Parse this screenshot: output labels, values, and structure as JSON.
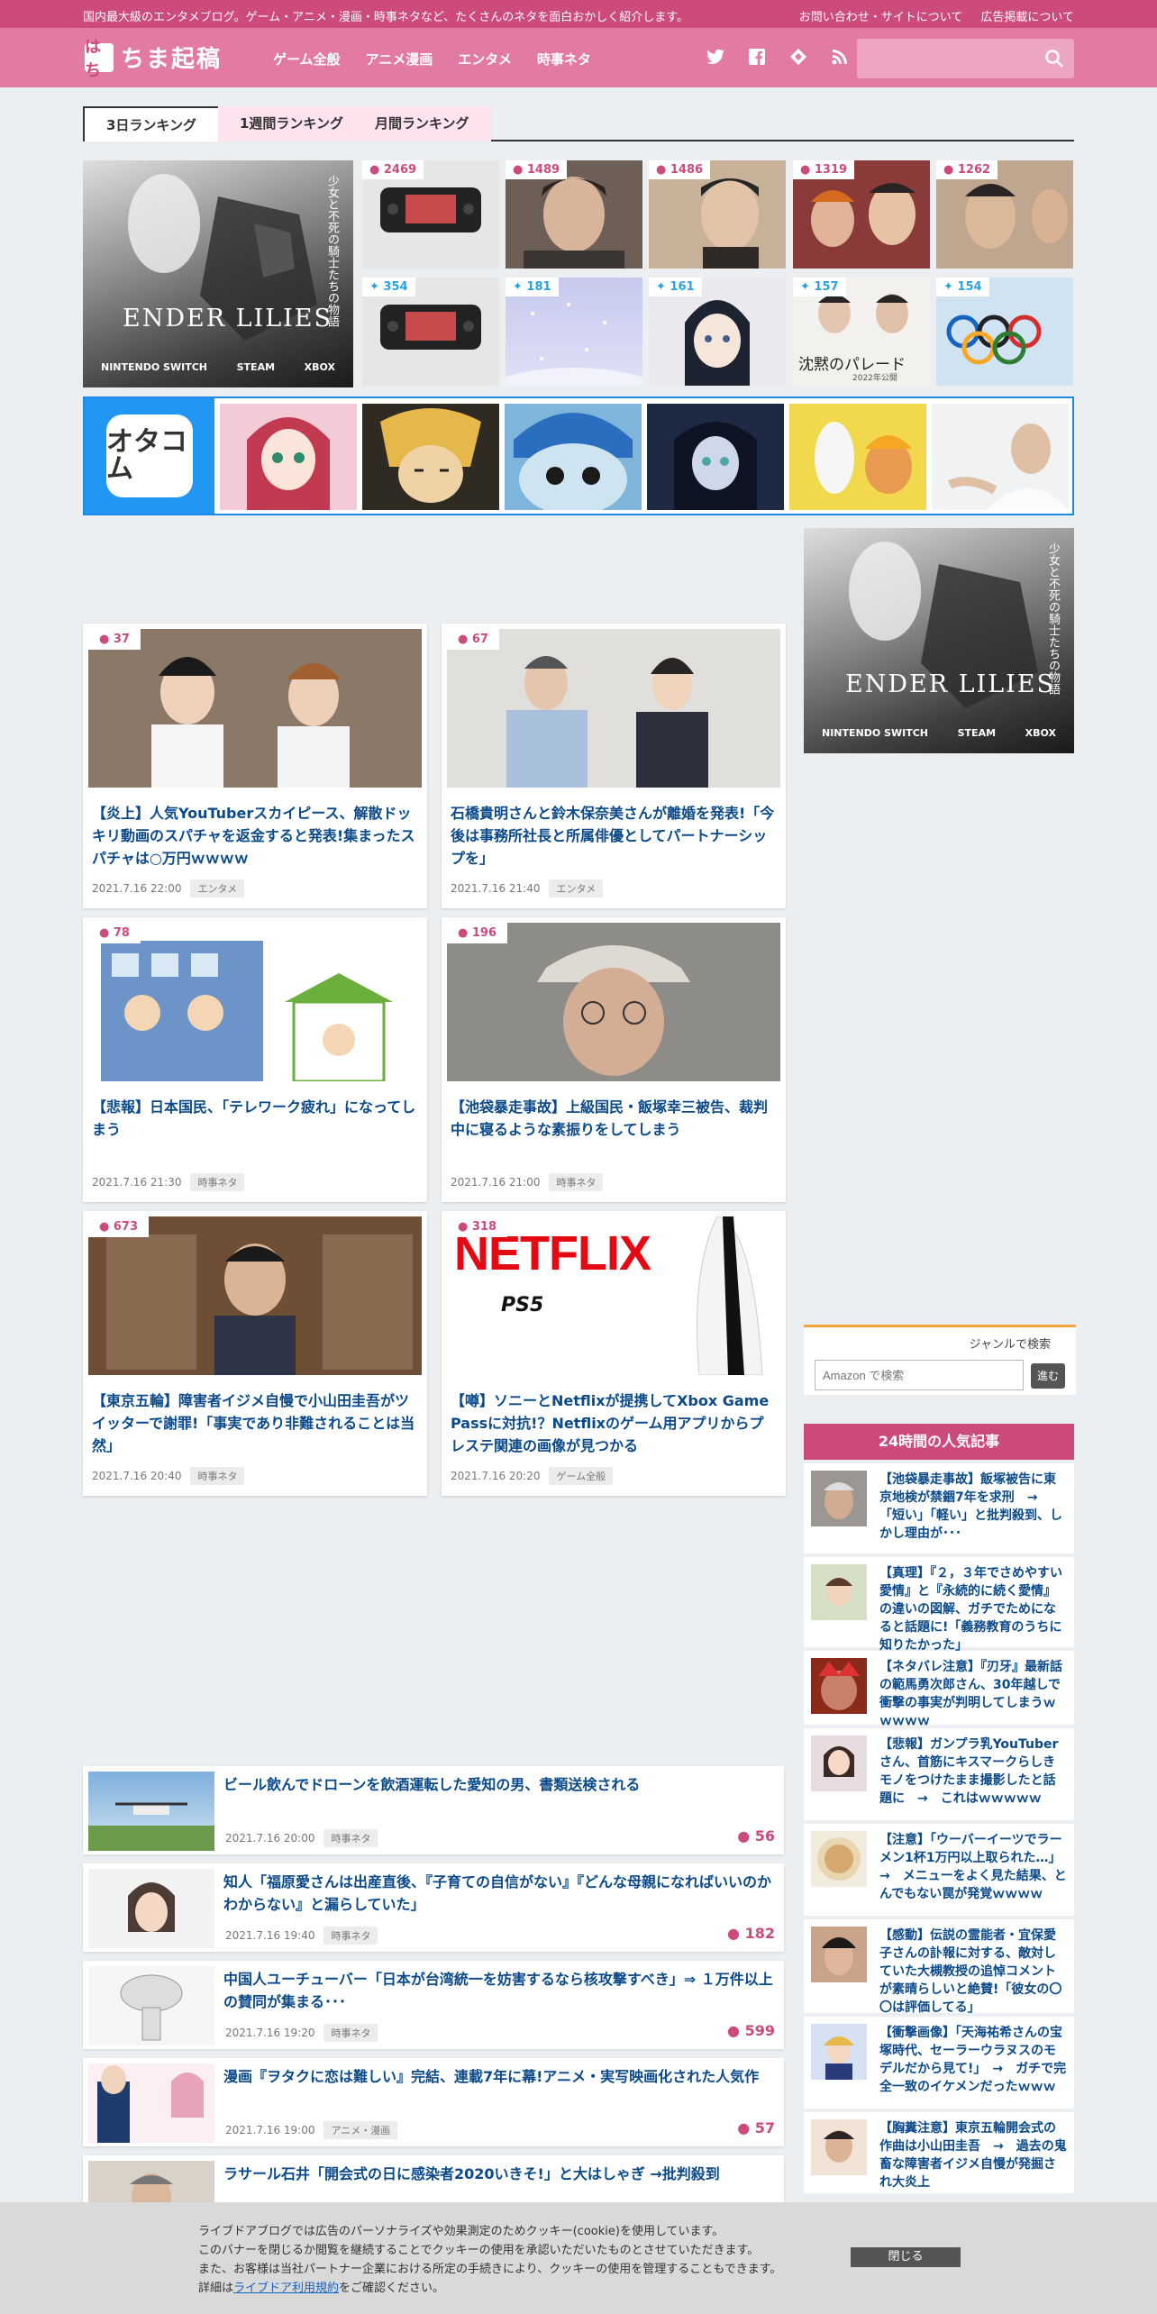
{
  "topbar": {
    "tagline": "国内最大級のエンタメブログ。ゲーム・アニメ・漫画・時事ネタなど、たくさんのネタを面白おかしく紹介します。",
    "contact": "お問い合わせ・サイトについて",
    "ads": "広告掲載について"
  },
  "header": {
    "logo_mark": "はち",
    "logo_text": "ちま起稿",
    "nav": [
      "ゲーム全般",
      "アニメ漫画",
      "エンタメ",
      "時事ネタ"
    ]
  },
  "tabs": [
    "3日ランキング",
    "1週間ランキング",
    "月間ランキング"
  ],
  "hero": {
    "title": "ENDER LILIES",
    "subtitle": "少女と不死の騎士たちの物語",
    "logos": [
      "NINTENDO SWITCH",
      "STEAM",
      "XBOX"
    ]
  },
  "ranking_comments": [
    "2469",
    "1489",
    "1486",
    "1319",
    "1262"
  ],
  "ranking_tweets": [
    "354",
    "181",
    "161",
    "157",
    "154"
  ],
  "ranking_extra": {
    "movie_title": "沈黙のパレード",
    "movie_sub": "2022年公開"
  },
  "otacom": {
    "logo": "オタコム"
  },
  "cards": [
    {
      "count": "37",
      "title": "【炎上】人気YouTuberスカイピース、解散ドッキリ動画のスパチャを返金すると発表!集まったスパチャは○万円ｗｗｗｗ",
      "date": "2021.7.16 22:00",
      "cat": "エンタメ"
    },
    {
      "count": "67",
      "title": "石橋貴明さんと鈴木保奈美さんが離婚を発表!「今後は事務所社長と所属俳優としてパートナーシップを」",
      "date": "2021.7.16 21:40",
      "cat": "エンタメ"
    },
    {
      "count": "78",
      "title": "【悲報】日本国民、「テレワーク疲れ」になってしまう",
      "date": "2021.7.16 21:30",
      "cat": "時事ネタ"
    },
    {
      "count": "196",
      "title": "【池袋暴走事故】上級国民・飯塚幸三被告、裁判中に寝るような素振りをしてしまう",
      "date": "2021.7.16 21:00",
      "cat": "時事ネタ"
    },
    {
      "count": "673",
      "title": "【東京五輪】障害者イジメ自慢で小山田圭吾がツイッターで謝罪!「事実であり非難されることは当然」",
      "date": "2021.7.16 20:40",
      "cat": "時事ネタ"
    },
    {
      "count": "318",
      "title": "【噂】ソニーとNetflixが提携してXbox Game Passに対抗!？Netflixのゲーム用アプリからプレステ関連の画像が見つかる",
      "date": "2021.7.16 20:20",
      "cat": "ゲーム全般"
    }
  ],
  "netflix": {
    "brand": "NETFLIX",
    "ps5": "PS5"
  },
  "list": [
    {
      "title": "ビール飲んでドローンを飲酒運転した愛知の男、書類送検される",
      "date": "2021.7.16 20:00",
      "cat": "時事ネタ",
      "count": "56"
    },
    {
      "title": "知人「福原愛さんは出産直後、『子育ての自信がない』『どんな母親になればいいのかわからない』と漏らしていた」",
      "date": "2021.7.16 19:40",
      "cat": "時事ネタ",
      "count": "182"
    },
    {
      "title": "中国人ユーチューバー「日本が台湾統一を妨害するなら核攻撃すべき」⇒ １万件以上の賛同が集まる･･･",
      "date": "2021.7.16 19:20",
      "cat": "時事ネタ",
      "count": "599"
    },
    {
      "title": "漫画『ヲタクに恋は難しい』完結、連載7年に幕!アニメ・実写映画化された人気作",
      "date": "2021.7.16 19:00",
      "cat": "アニメ・漫画",
      "count": "57"
    },
    {
      "title": "ラサール石井「開会式の日に感染者2020いきそ!」と大はしゃぎ →批判殺到",
      "date": "",
      "cat": "",
      "count": ""
    }
  ],
  "genre": {
    "label": "ジャンルで検索",
    "placeholder": "Amazon で検索",
    "go": "進む"
  },
  "popular": {
    "heading": "24時間の人気記事",
    "items": [
      "【池袋暴走事故】飯塚被告に東京地検が禁錮7年を求刑　→　「短い」「軽い」と批判殺到、しかし理由が･･･",
      "【真理】『２，３年でさめやすい愛情』と『永続的に続く愛情』の違いの図解、ガチでためになると話題に!「義務教育のうちに知りたかった」",
      "【ネタバレ注意】『刃牙』最新話の範馬勇次郎さん、30年越しで衝撃の事実が判明してしまうｗｗｗｗｗ",
      "【悲報】ガンプラ乳YouTuberさん、首筋にキスマークらしきモノをつけたまま撮影したと話題に　→　これはｗｗｗｗｗ",
      "【注意】「ウーバーイーツでラーメン1杯1万円以上取られた…」　→　メニューをよく見た結果、とんでもない罠が発覚ｗｗｗｗ",
      "【感動】伝説の霊能者・宜保愛子さんの訃報に対する、敵対していた大槻教授の追悼コメントが素晴らしいと絶賛!「彼女の〇〇は評価してる」",
      "【衝撃画像】「天海祐希さんの宝塚時代、セーラーウラヌスのモデルだから見て!」　→　ガチで完全一致のイケメンだったｗｗｗ",
      "【胸糞注意】東京五輪開会式の作曲は小山田圭吾　→　過去の鬼畜な障害者イジメ自慢が発掘され大炎上"
    ]
  },
  "cookie": {
    "line1": "ライブドアブログでは広告のパーソナライズや効果測定のためクッキー(cookie)を使用しています。",
    "line2": "このバナーを閉じるか閲覧を継続することでクッキーの使用を承認いただいたものとさせていただきます。",
    "line3": "また、お客様は当社パートナー企業における所定の手続きにより、クッキーの使用を管理することもできます。",
    "line4_pre": "詳細は",
    "line4_link": "ライブドア利用規約",
    "line4_post": "をご確認ください。",
    "close": "閉じる"
  }
}
